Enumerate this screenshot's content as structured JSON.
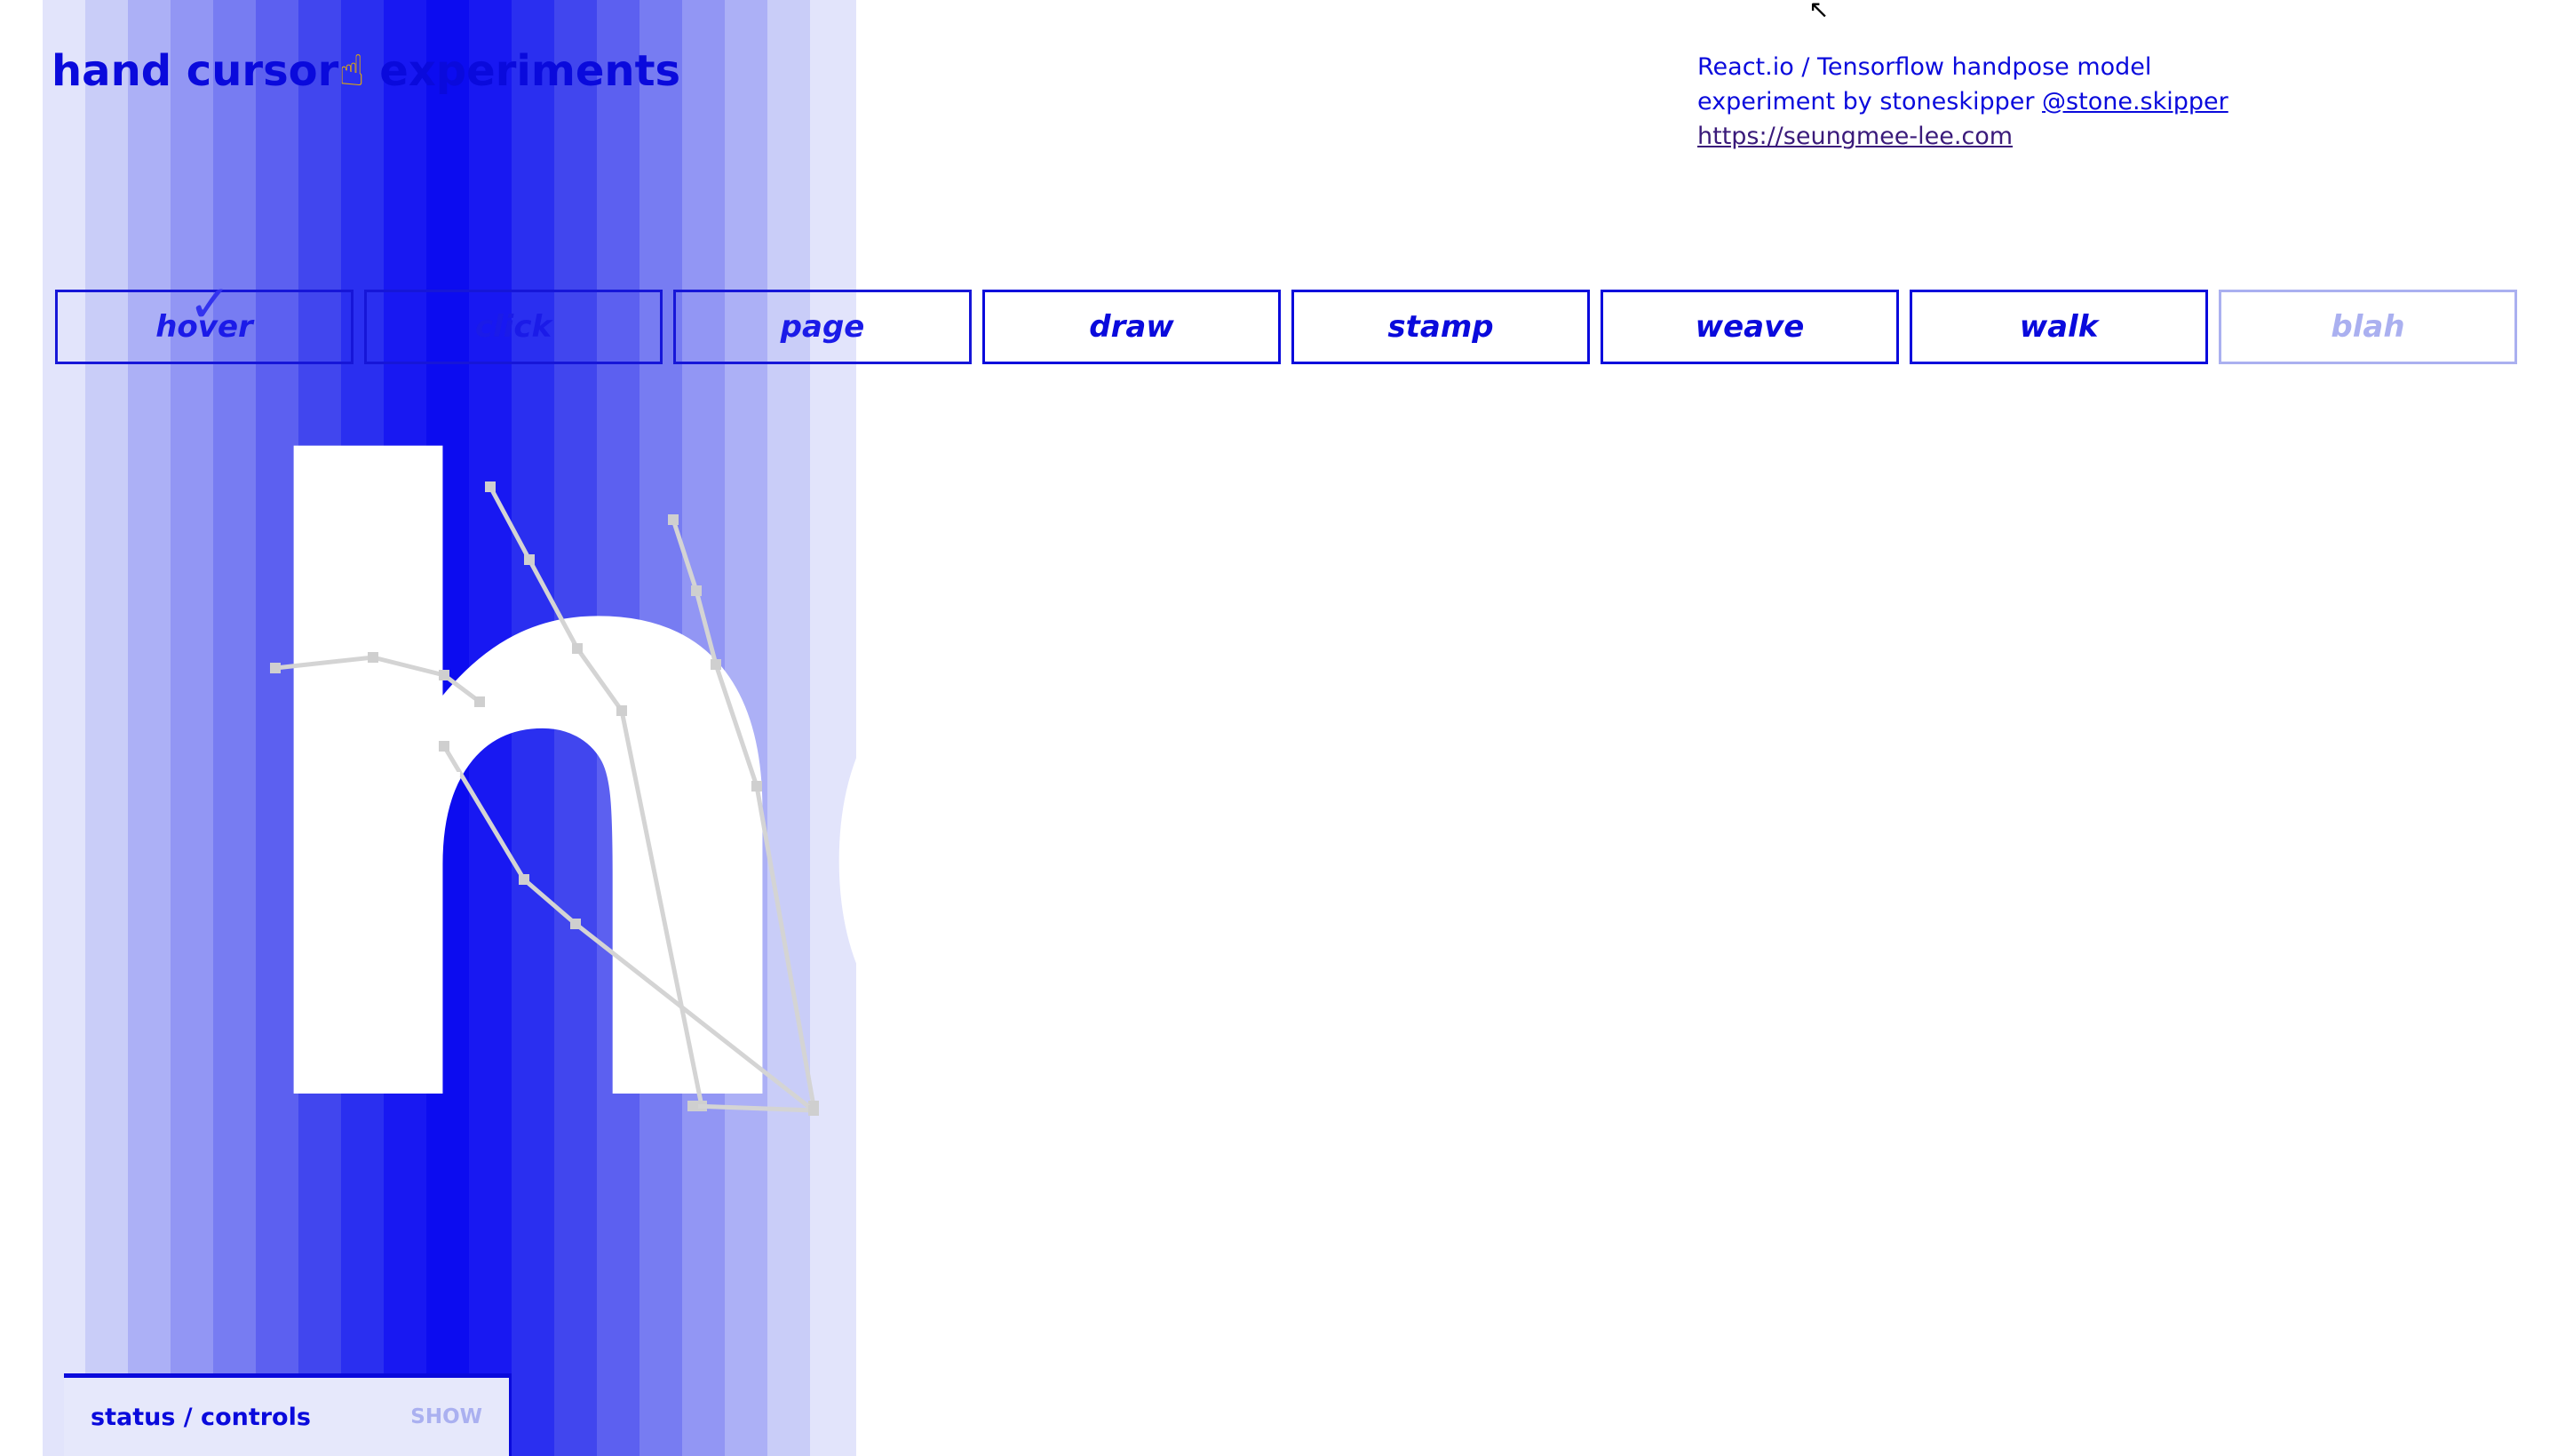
{
  "header": {
    "title_part1": "hand cursor",
    "title_emoji": "☝",
    "title_part2": " experiments"
  },
  "credits": {
    "line1": "React.io / Tensorflow handpose model",
    "line2_prefix": "experiment by stoneskipper ",
    "line2_link": "@stone.skipper",
    "url": "https://seungmee-lee.com"
  },
  "tabs": [
    {
      "label": "hover"
    },
    {
      "label": "click"
    },
    {
      "label": "page"
    },
    {
      "label": "draw"
    },
    {
      "label": "stamp"
    },
    {
      "label": "weave"
    },
    {
      "label": "walk"
    },
    {
      "label": "blah"
    }
  ],
  "active_tab": "hover",
  "check_mark": "✓",
  "big_word": "hover",
  "status_panel": {
    "label": "status / controls",
    "toggle": "SHOW"
  },
  "colors": {
    "accent": "#0a0adc",
    "faded": "#aab0f0",
    "panel": "#e6e8fb"
  }
}
